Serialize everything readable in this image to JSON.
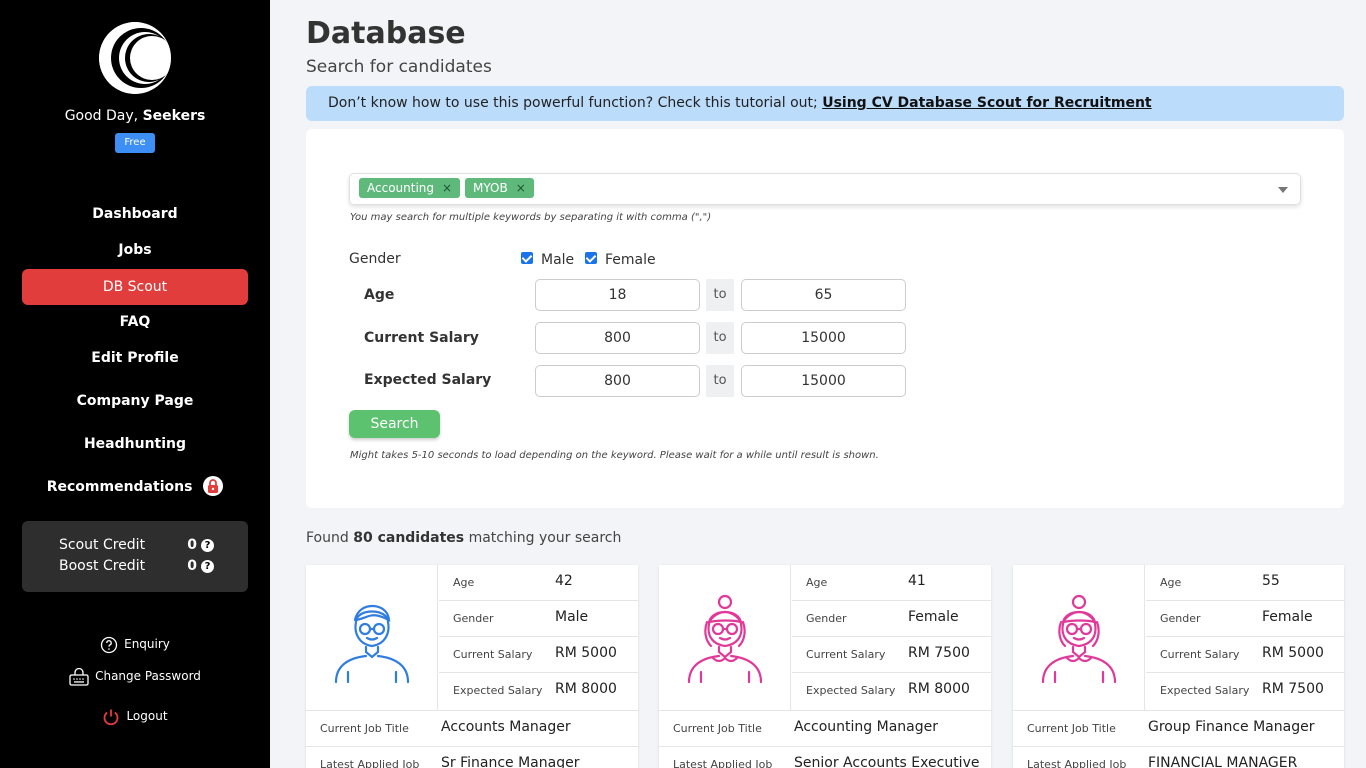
{
  "sidebar": {
    "greeting_prefix": "Good Day,",
    "user_name": "Seekers",
    "plan_badge": "Free",
    "nav": [
      {
        "label": "Dashboard"
      },
      {
        "label": "Jobs"
      },
      {
        "label": "DB Scout"
      },
      {
        "label": "FAQ"
      },
      {
        "label": "Edit Profile"
      },
      {
        "label": "Company Page"
      },
      {
        "label": "Headhunting"
      },
      {
        "label": "Recommendations"
      }
    ],
    "credits": [
      {
        "label": "Scout Credit",
        "value": "0"
      },
      {
        "label": "Boost Credit",
        "value": "0"
      }
    ],
    "footer": {
      "enquiry": "Enquiry",
      "change_password": "Change Password",
      "logout": "Logout"
    }
  },
  "main": {
    "title": "Database",
    "subtitle": "Search for candidates",
    "tutorial_text": "Don’t know how to use this powerful function? Check this tutorial out;",
    "tutorial_link": "Using CV Database Scout for Recruitment",
    "tags": [
      "Accounting",
      "MYOB"
    ],
    "keyword_hint": "You may search for multiple keywords by separating it with comma (\",\")",
    "gender_label": "Gender",
    "gender_options": [
      "Male",
      "Female"
    ],
    "age_label": "Age",
    "age_min": "18",
    "age_max": "65",
    "current_salary_label": "Current Salary",
    "current_salary_min": "800",
    "current_salary_max": "15000",
    "expected_salary_label": "Expected Salary",
    "expected_salary_min": "800",
    "expected_salary_max": "15000",
    "to_label": "to",
    "search_button": "Search",
    "load_hint": "Might takes 5-10 seconds to load depending on the keyword. Please wait for a while until result is shown.",
    "found_prefix": "Found",
    "found_count": "80 candidates",
    "found_suffix": "matching your search"
  },
  "field_labels": {
    "age": "Age",
    "gender": "Gender",
    "current_salary": "Current Salary",
    "expected_salary": "Expected Salary",
    "current_job_title": "Current Job Title",
    "latest_applied_job": "Latest Applied Job"
  },
  "candidates": [
    {
      "age": "42",
      "gender": "Male",
      "current_salary": "RM 5000",
      "expected_salary": "RM 8000",
      "current_job_title": "Accounts Manager",
      "latest_applied_job": "Sr Finance Manager",
      "avatar_color": "#2f7de1"
    },
    {
      "age": "41",
      "gender": "Female",
      "current_salary": "RM 7500",
      "expected_salary": "RM 8000",
      "current_job_title": "Accounting Manager",
      "latest_applied_job": "Senior Accounts Executive",
      "avatar_color": "#e0399a"
    },
    {
      "age": "55",
      "gender": "Female",
      "current_salary": "RM 5000",
      "expected_salary": "RM 7500",
      "current_job_title": "Group Finance Manager",
      "latest_applied_job": "FINANCIAL MANAGER",
      "avatar_color": "#e0399a"
    }
  ],
  "colors": {
    "sidebar_bg": "#000000",
    "active_nav": "#e23d3d",
    "tag_green": "#5fb97b",
    "search_green": "#5cc26f",
    "info_blue": "#bcdcfb"
  },
  "icons": {
    "logo": "crescent-logo",
    "lock": "lock-icon",
    "help": "question-icon",
    "enquiry": "question-bubble-icon",
    "password": "keyboard-lock-icon",
    "logout": "power-icon"
  }
}
